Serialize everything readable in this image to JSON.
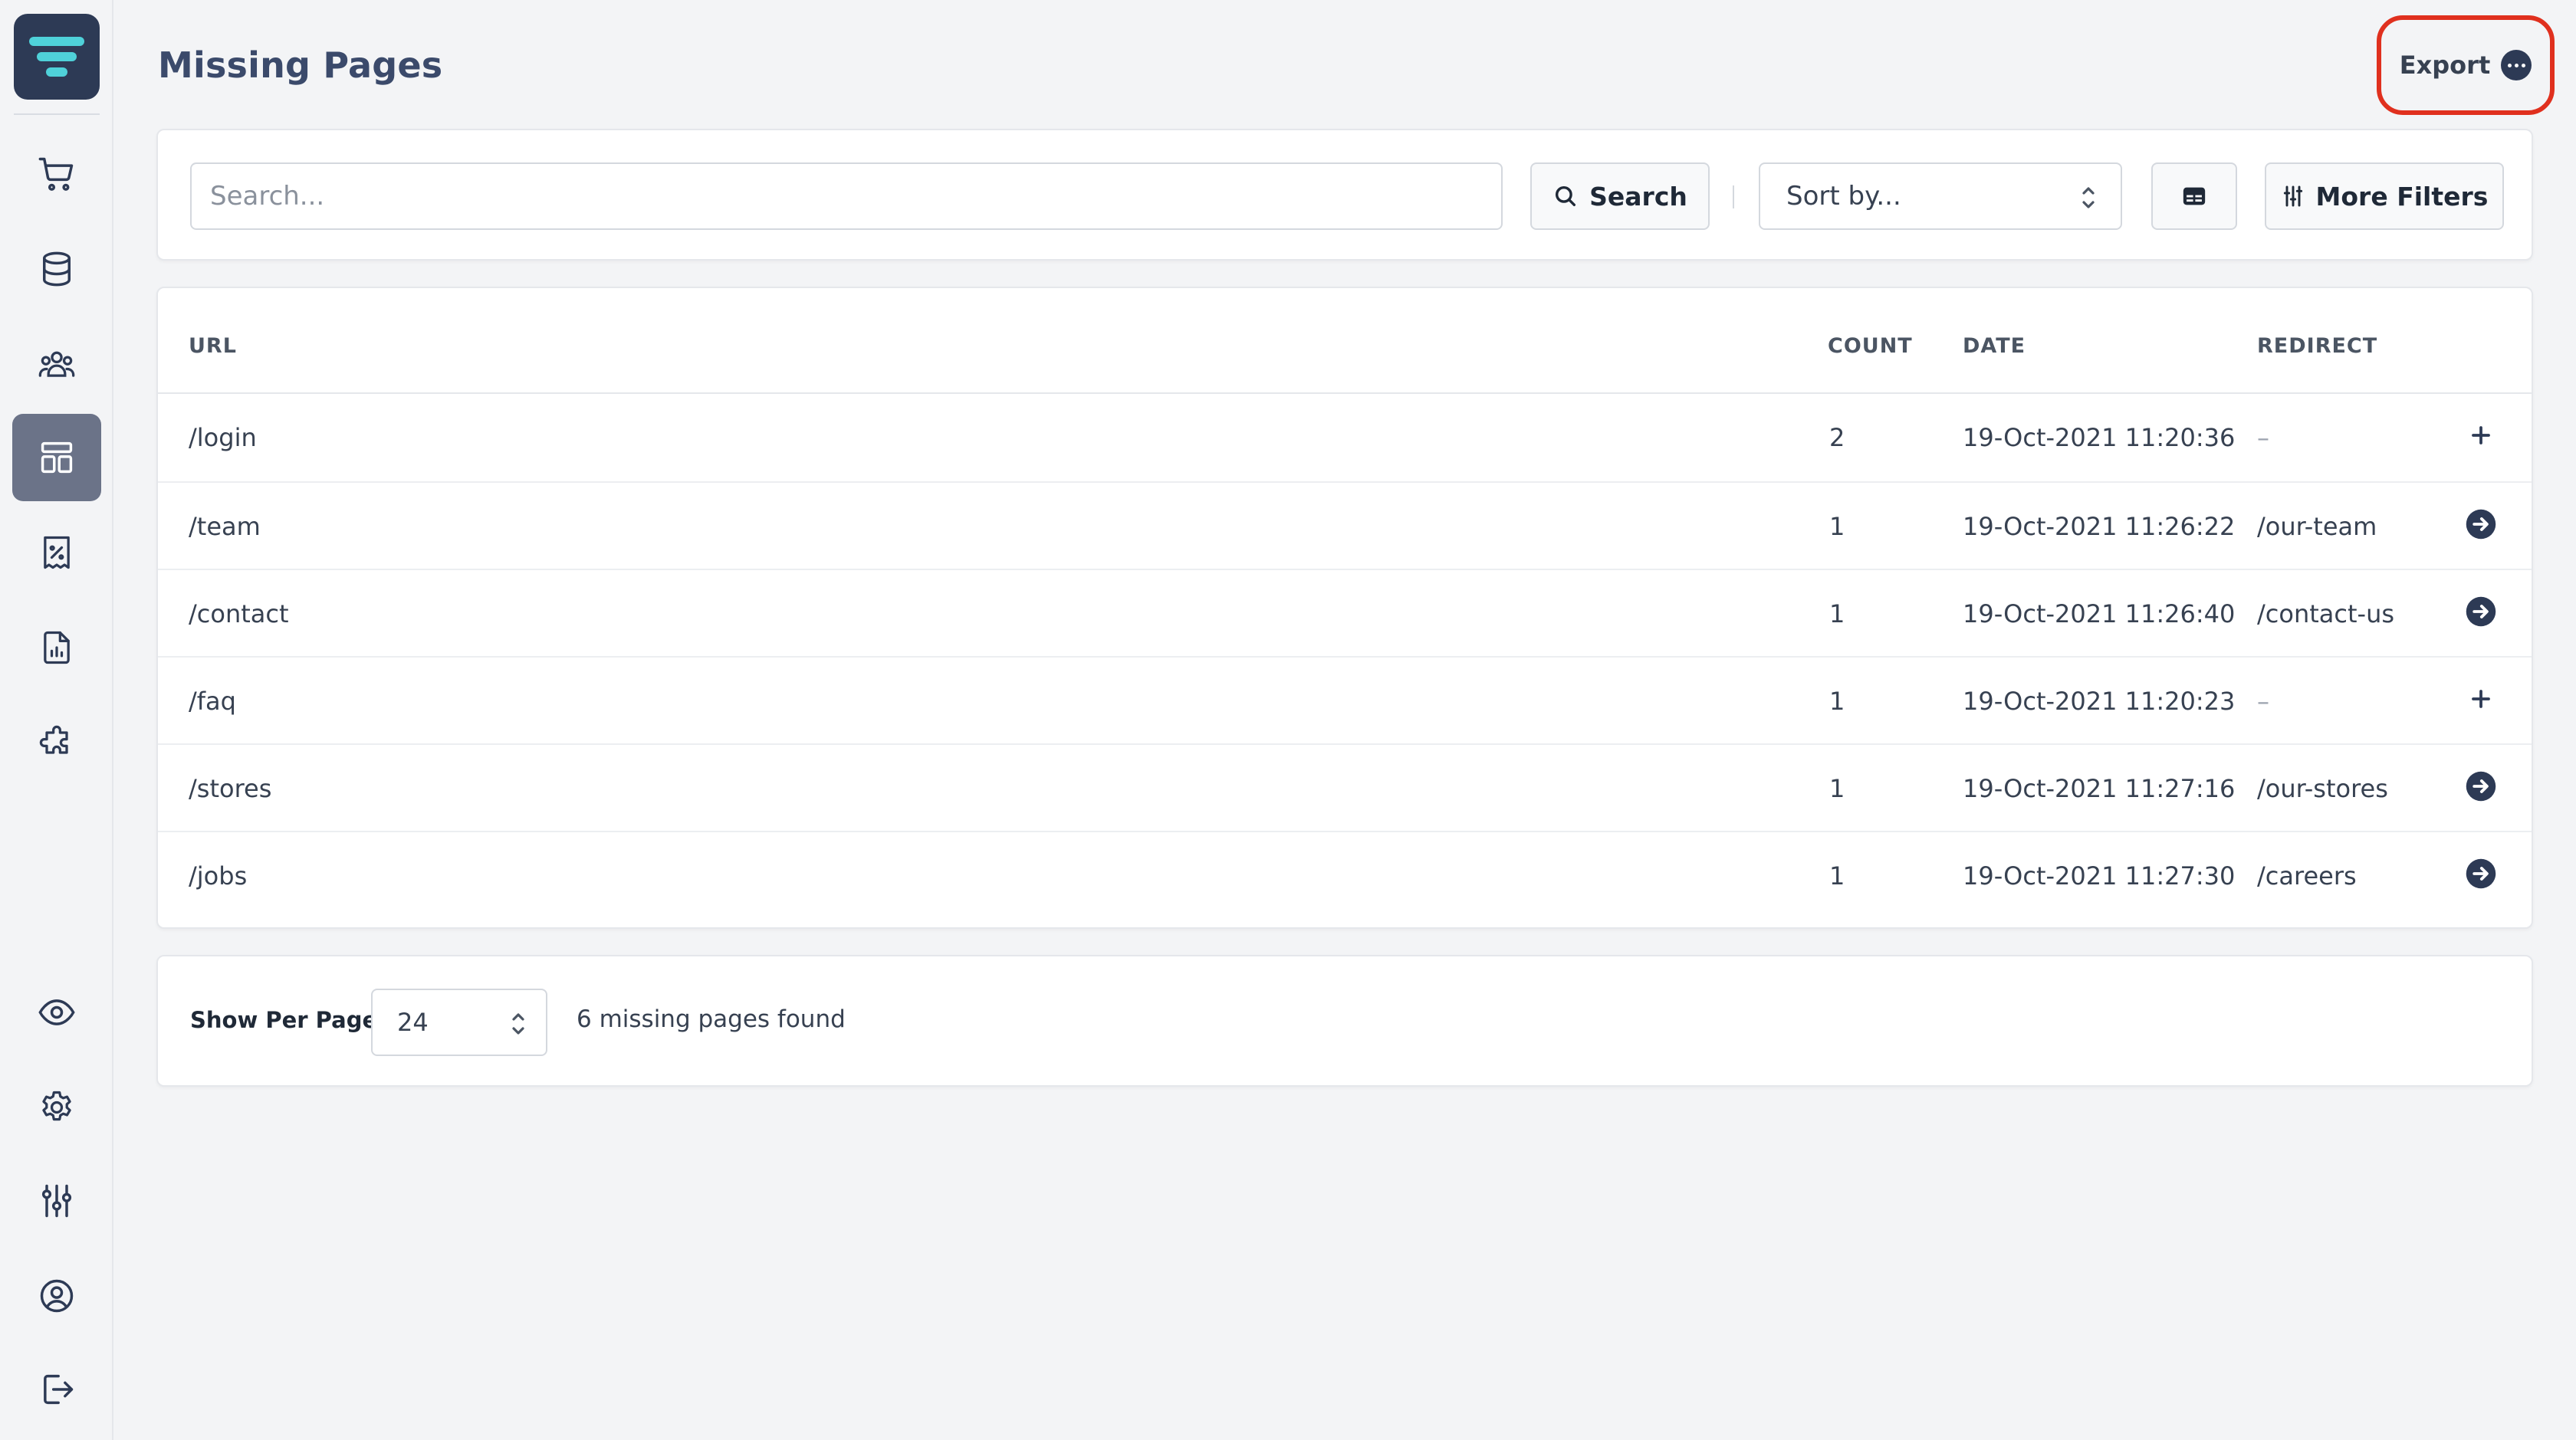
{
  "page": {
    "title": "Missing Pages"
  },
  "header": {
    "export_label": "Export"
  },
  "sidebar": {
    "items": [
      {
        "name": "cart-icon",
        "active": false
      },
      {
        "name": "database-icon",
        "active": false
      },
      {
        "name": "users-icon",
        "active": false
      },
      {
        "name": "layout-icon",
        "active": true
      },
      {
        "name": "receipt-percent-icon",
        "active": false
      },
      {
        "name": "report-icon",
        "active": false
      },
      {
        "name": "puzzle-icon",
        "active": false
      },
      {
        "name": "eye-icon",
        "active": false
      },
      {
        "name": "gear-icon",
        "active": false
      },
      {
        "name": "sliders-icon",
        "active": false
      },
      {
        "name": "user-circle-icon",
        "active": false
      },
      {
        "name": "logout-icon",
        "active": false
      }
    ]
  },
  "filters": {
    "search_placeholder": "Search...",
    "search_label": "Search",
    "sort_placeholder": "Sort by...",
    "more_filters_label": "More Filters"
  },
  "table": {
    "headers": {
      "url": "URL",
      "count": "COUNT",
      "date": "DATE",
      "redirect": "REDIRECT"
    },
    "rows": [
      {
        "url": "/login",
        "count": "2",
        "date": "19-Oct-2021 11:20:36",
        "redirect": "–",
        "action": "plus-icon"
      },
      {
        "url": "/team",
        "count": "1",
        "date": "19-Oct-2021 11:26:22",
        "redirect": "/our-team",
        "action": "arrow-circle-right-icon"
      },
      {
        "url": "/contact",
        "count": "1",
        "date": "19-Oct-2021 11:26:40",
        "redirect": "/contact-us",
        "action": "arrow-circle-right-icon"
      },
      {
        "url": "/faq",
        "count": "1",
        "date": "19-Oct-2021 11:20:23",
        "redirect": "–",
        "action": "plus-icon"
      },
      {
        "url": "/stores",
        "count": "1",
        "date": "19-Oct-2021 11:27:16",
        "redirect": "/our-stores",
        "action": "arrow-circle-right-icon"
      },
      {
        "url": "/jobs",
        "count": "1",
        "date": "19-Oct-2021 11:27:30",
        "redirect": "/careers",
        "action": "arrow-circle-right-icon"
      }
    ]
  },
  "footer": {
    "show_per_page_label": "Show Per Page",
    "per_page_value": "24",
    "found_text": "6 missing pages found"
  },
  "colors": {
    "accent_dark": "#2d3a55",
    "active_nav": "#6b7388",
    "logo_cyan": "#4fd1d9",
    "highlight_ring": "#e0301e"
  }
}
